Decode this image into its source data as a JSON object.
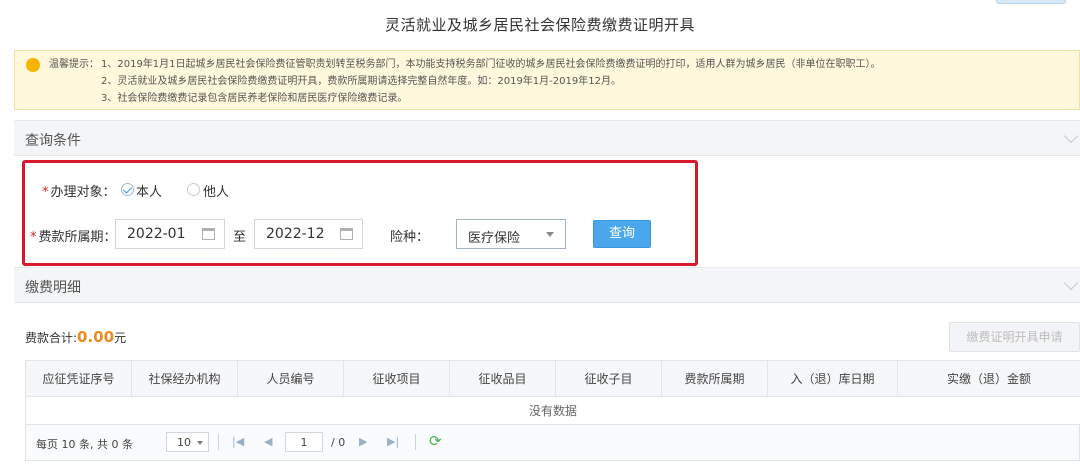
{
  "page": {
    "title": "灵活就业及城乡居民社会保险费缴费证明开具"
  },
  "notice": {
    "lead": "温馨提示：",
    "lines": [
      "1、2019年1月1日起城乡居民社会保险费征管职责划转至税务部门，本功能支持税务部门征收的城乡居民社会保险费缴费证明的打印，适用人群为城乡居民（非单位在职职工）。",
      "2、灵活就业及城乡居民社会保险费缴费证明开具，费款所属期请选择完整自然年度。如：2019年1月-2019年12月。",
      "3、社会保险费缴费记录包含居民养老保险和居民医疗保险缴费记录。"
    ]
  },
  "query": {
    "section_title": "查询条件",
    "target_label": "办理对象：",
    "required_mark": "*",
    "option_self": "本人",
    "option_other": "他人",
    "selected": "本人",
    "period_label": "费款所属期：",
    "period_start": "2022-01",
    "period_to": "至",
    "period_end": "2022-12",
    "insurance_label": "险种：",
    "insurance_value": "医疗保险",
    "query_button": "查询"
  },
  "detail": {
    "section_title": "缴费明细",
    "total_label": "费款合计:",
    "total_amount": "0.00",
    "total_unit": "元",
    "apply_button": "缴费证明开具申请",
    "columns": [
      "应征凭证序号",
      "社保经办机构",
      "人员编号",
      "征收项目",
      "征收品目",
      "征收子目",
      "费款所属期",
      "入（退）库日期",
      "实缴（退）金额"
    ],
    "empty_text": "没有数据"
  },
  "pager": {
    "info": "每页 10 条, 共 0 条",
    "page_size": "10",
    "current_page": "1",
    "total_pages": "/ 0"
  },
  "colors": {
    "accent": "#4aa7ee",
    "highlight_border": "#d9182e",
    "amount": "#f08a1c",
    "notice_bg": "#fff8dc"
  }
}
